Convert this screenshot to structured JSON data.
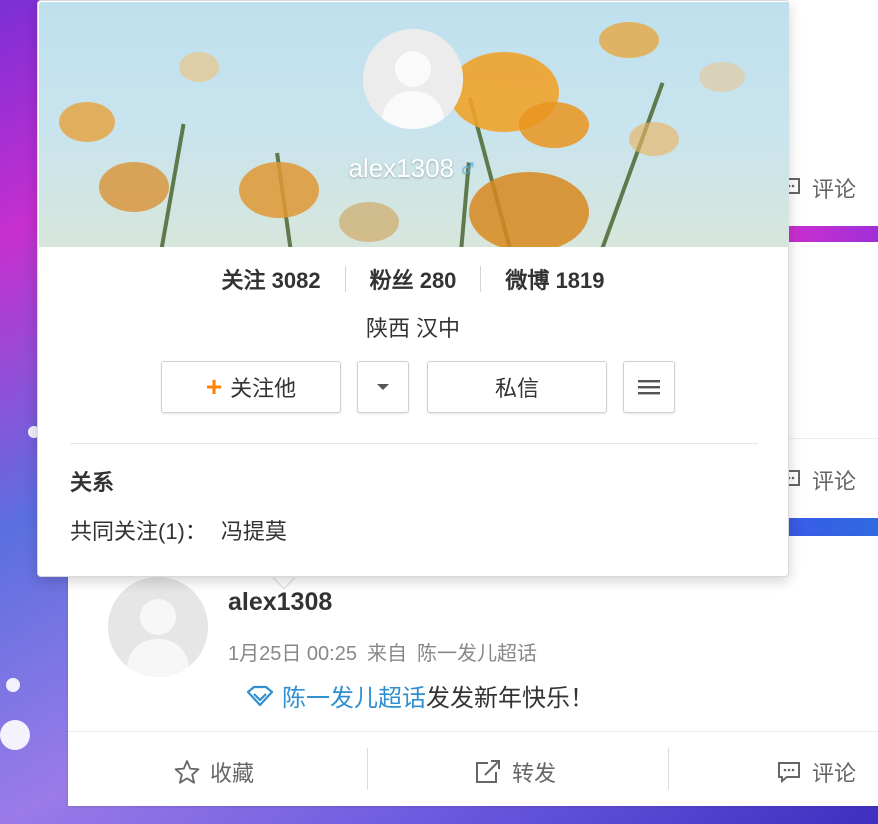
{
  "popup": {
    "username": "alex1308",
    "gender_icon": "male-icon",
    "stats": [
      {
        "label": "关注",
        "value": "3082"
      },
      {
        "label": "粉丝",
        "value": "280"
      },
      {
        "label": "微博",
        "value": "1819"
      }
    ],
    "location": "陕西 汉中",
    "follow_button": "关注他",
    "message_button": "私信",
    "relation_title": "关系",
    "mutual_label": "共同关注(1)：",
    "mutual_name": "冯提莫"
  },
  "feed": {
    "card1_comment": "评论",
    "card2_comment": "评论",
    "post": {
      "username": "alex1308",
      "date": "1月25日 00:25",
      "source_prefix": "来自",
      "source": "陈一发儿超话",
      "topic": "陈一发儿超话",
      "text": "发发新年快乐！"
    },
    "actions": {
      "collect": "收藏",
      "repost": "转发",
      "comment": "评论"
    }
  },
  "colors": {
    "accent_orange": "#ff8200",
    "link_blue": "#2f8fd0",
    "gender_blue": "#5fb6e8"
  }
}
